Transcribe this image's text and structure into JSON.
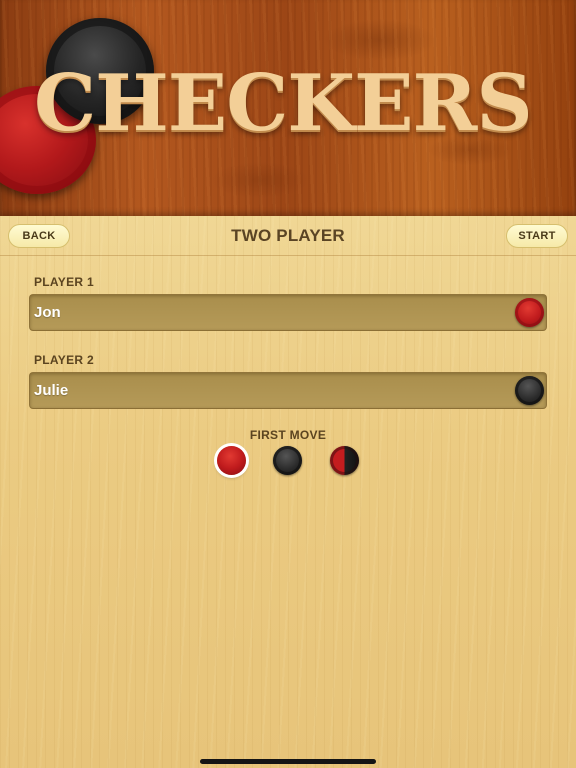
{
  "header": {
    "logo_text": "CHECKERS"
  },
  "nav": {
    "back_label": "BACK",
    "title": "TWO PLAYER",
    "start_label": "START"
  },
  "players": [
    {
      "label": "PLAYER 1",
      "name": "Jon",
      "piece_color": "red"
    },
    {
      "label": "PLAYER 2",
      "name": "Julie",
      "piece_color": "black"
    }
  ],
  "first_move": {
    "label": "FIRST MOVE",
    "options": [
      "red",
      "black",
      "random"
    ],
    "selected": "red"
  },
  "colors": {
    "red_piece": "#c01b1d",
    "black_piece": "#2a2a2a",
    "panel_wood": "#ebcb82",
    "header_wood": "#a34e1a",
    "text_brown": "#5a4424"
  }
}
